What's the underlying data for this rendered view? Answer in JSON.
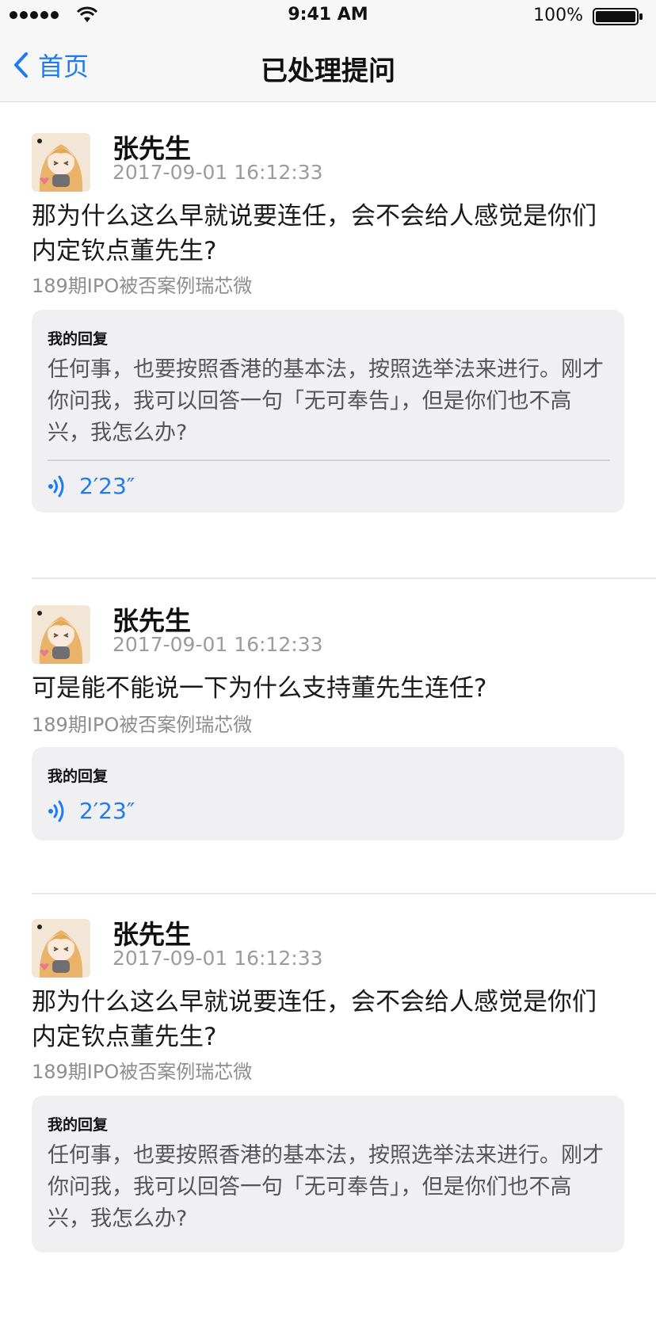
{
  "status_bar": {
    "time": "9:41 AM",
    "battery": "100%"
  },
  "nav": {
    "back_label": "首页",
    "title": "已处理提问"
  },
  "posts": [
    {
      "user": "张先生",
      "date": "2017-09-01 16:12:33",
      "question": "那为什么这么早就说要连任，会不会给人感觉是你们内定钦点董先生?",
      "source": "189期IPO被否案例瑞芯微",
      "reply_label": "我的回复",
      "reply_text": "任何事，也要按照香港的基本法，按照选举法来进行。刚才你问我，我可以回答一句「无可奉告」，但是你们也不高兴，我怎么办?",
      "audio_duration": "2′23″"
    },
    {
      "user": "张先生",
      "date": "2017-09-01 16:12:33",
      "question": "可是能不能说一下为什么支持董先生连任?",
      "source": "189期IPO被否案例瑞芯微",
      "reply_label": "我的回复",
      "audio_duration": "2′23″"
    },
    {
      "user": "张先生",
      "date": "2017-09-01 16:12:33",
      "question": "那为什么这么早就说要连任，会不会给人感觉是你们内定钦点董先生?",
      "source": "189期IPO被否案例瑞芯微",
      "reply_label": "我的回复",
      "reply_text": "任何事，也要按照香港的基本法，按照选举法来进行。刚才你问我，我可以回答一句「无可奉告」，但是你们也不高兴，我怎么办?"
    }
  ],
  "colors": {
    "accent": "#1e7bf2",
    "reply_bg": "#f0f0f3",
    "muted": "#9b9ba0"
  }
}
